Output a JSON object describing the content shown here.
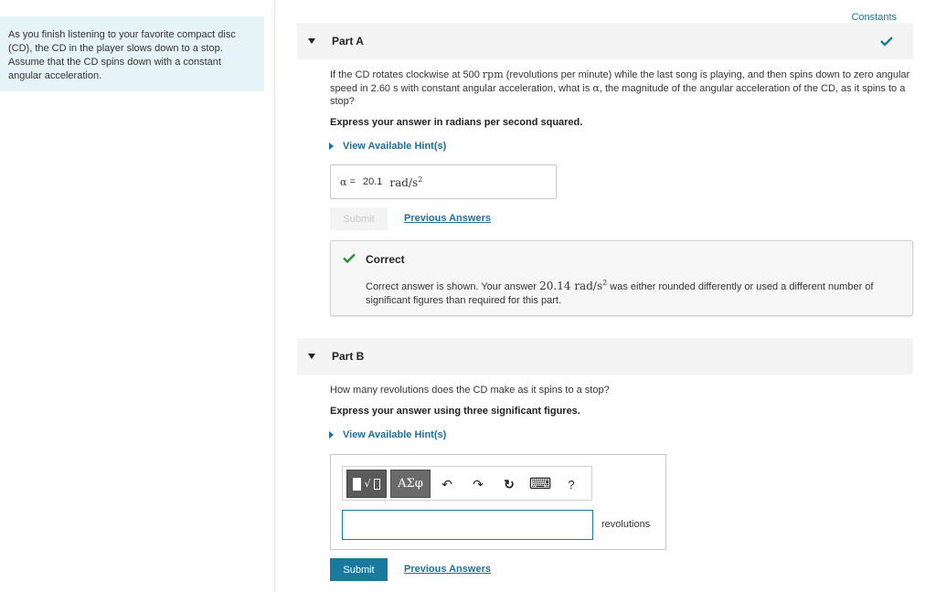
{
  "problem": {
    "intro": "As you finish listening to your favorite compact disc (CD), the CD in the player slows down to a stop. Assume that the CD spins down with a constant angular acceleration."
  },
  "constants_link": "Constants",
  "part_a": {
    "title": "Part A",
    "question_1": "If the CD rotates clockwise at 500 ",
    "question_rpm": "rpm",
    "question_2": " (revolutions per minute) while the last song is playing, and then spins down to zero angular speed in 2.60 s with constant angular acceleration, what is ",
    "question_alpha": "α",
    "question_3": ", the magnitude of the angular acceleration of the CD, as it spins to a stop?",
    "instruction": "Express your answer in radians per second squared.",
    "hint_link": "View Available Hint(s)",
    "answer": {
      "variable": "α",
      "equals": " = ",
      "value": "20.1",
      "unit": "rad/s",
      "unit_exp": "2"
    },
    "submit_label": "Submit",
    "previous_answers": "Previous Answers",
    "feedback": {
      "title": "Correct",
      "body_1": "Correct answer is shown. Your answer ",
      "body_value": "20.14 rad/s",
      "body_exp": "2",
      "body_2": " was either rounded differently or used a different number of significant figures than required for this part."
    }
  },
  "part_b": {
    "title": "Part B",
    "question": "How many revolutions does the CD make as it spins to a stop?",
    "instruction": "Express your answer using three significant figures.",
    "hint_link": "View Available Hint(s)",
    "toolbar": {
      "templates_frac": "√",
      "greek": "ΑΣφ",
      "undo": "↶",
      "redo": "↷",
      "reset": "↻",
      "keyboard": "⌨",
      "help": "?"
    },
    "input_value": "",
    "unit": "revolutions",
    "submit_label": "Submit",
    "previous_answers": "Previous Answers"
  },
  "colors": {
    "accent": "#1a7a9e",
    "link": "#1f6f99",
    "success": "#2e8b3a",
    "intro_bg": "#e6f4f8"
  }
}
